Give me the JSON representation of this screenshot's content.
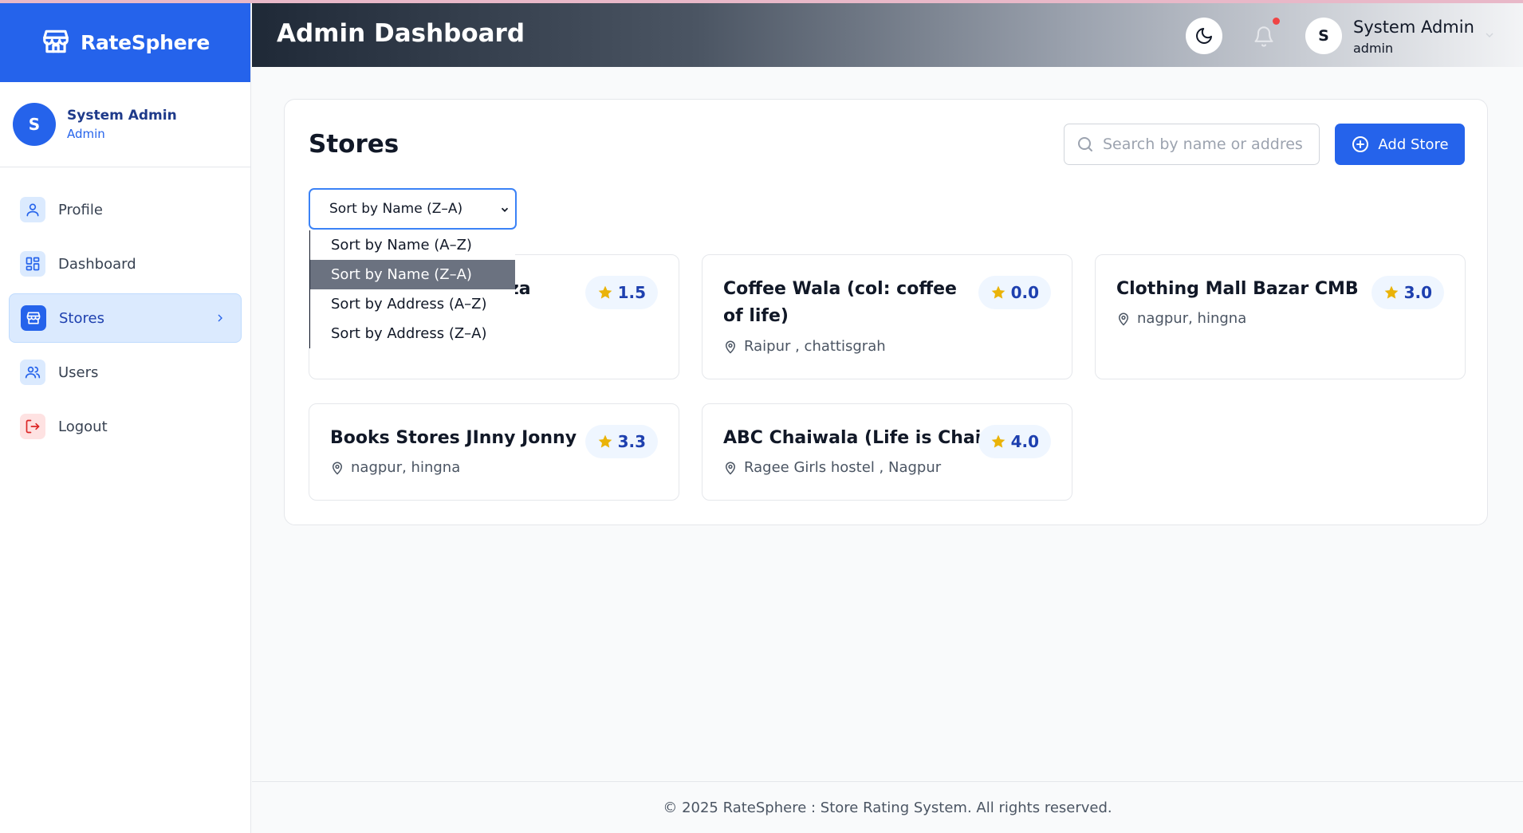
{
  "brand": {
    "name": "RateSphere"
  },
  "sidebar_user": {
    "initial": "S",
    "name": "System Admin",
    "role": "Admin"
  },
  "nav": {
    "profile": "Profile",
    "dashboard": "Dashboard",
    "stores": "Stores",
    "users": "Users",
    "logout": "Logout"
  },
  "header": {
    "title": "Admin Dashboard",
    "user_initial": "S",
    "user_name": "System Admin",
    "user_role": "admin"
  },
  "stores_panel": {
    "title": "Stores",
    "search_placeholder": "Search by name or address",
    "add_label": "Add Store",
    "sort_selected": "Sort by Name (Z–A)",
    "sort_options": [
      "Sort by Name (A–Z)",
      "Sort by Name (Z–A)",
      "Sort by Address (A–Z)",
      "Sort by Address (Z–A)"
    ]
  },
  "stores": [
    {
      "name_partial": "za",
      "rating": "1.5",
      "address": ""
    },
    {
      "name": "Coffee Wala (col: coffee of life)",
      "rating": "0.0",
      "address": "Raipur , chattisgrah"
    },
    {
      "name": "Clothing Mall Bazar CMB",
      "rating": "3.0",
      "address": "nagpur, hingna"
    },
    {
      "name": "Books Stores JInny Jonny",
      "rating": "3.3",
      "address": "nagpur, hingna"
    },
    {
      "name": "ABC Chaiwala (Life is Chai )",
      "rating": "4.0",
      "address": "Ragee Girls hostel , Nagpur"
    }
  ],
  "footer": {
    "text": "© 2025 RateSphere : Store Rating System. All rights reserved."
  },
  "colors": {
    "primary": "#2563eb",
    "star": "#eab308",
    "notification_dot": "#ef4444"
  }
}
